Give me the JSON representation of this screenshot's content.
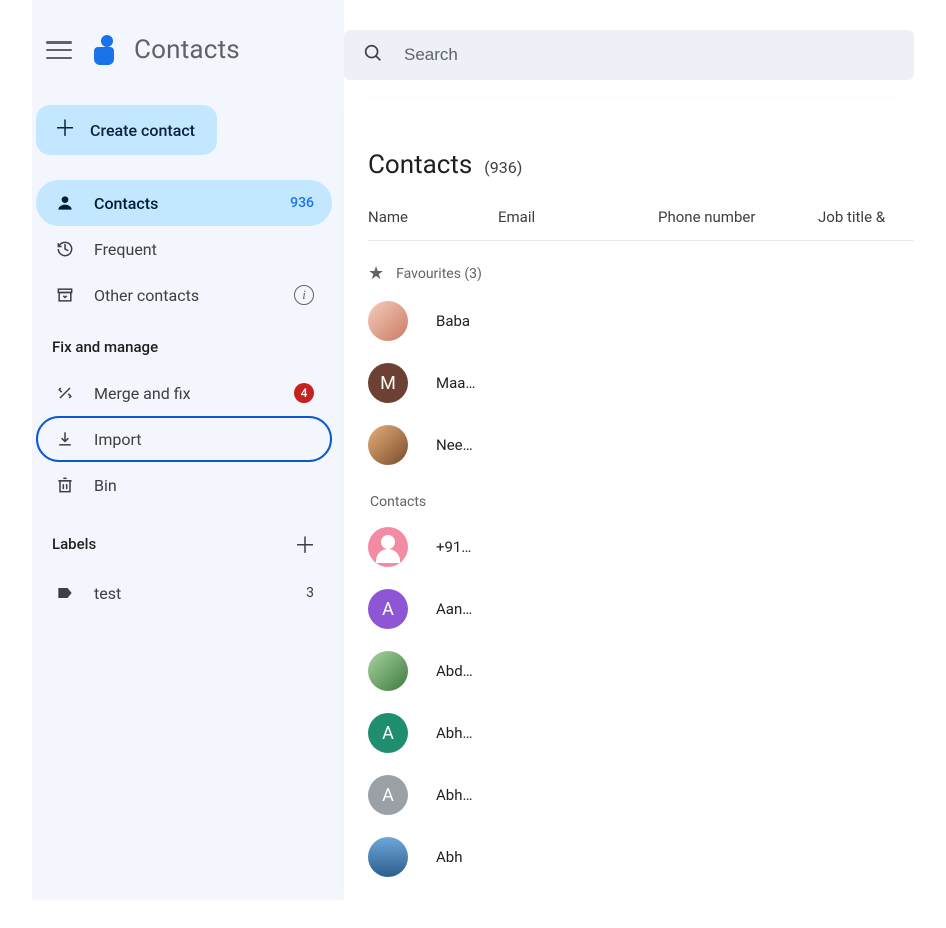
{
  "app": {
    "title": "Contacts"
  },
  "search": {
    "placeholder": "Search"
  },
  "sidebar": {
    "create_label": "Create contact",
    "nav": {
      "contacts": {
        "label": "Contacts",
        "count": "936"
      },
      "frequent": {
        "label": "Frequent"
      },
      "other": {
        "label": "Other contacts"
      }
    },
    "section_fix": "Fix and manage",
    "fix": {
      "merge": {
        "label": "Merge and fix",
        "badge": "4"
      },
      "import": {
        "label": "Import"
      },
      "bin": {
        "label": "Bin"
      }
    },
    "labels_heading": "Labels",
    "labels": [
      {
        "label": "test",
        "count": "3"
      }
    ]
  },
  "main": {
    "heading": "Contacts",
    "count_paren": "(936)",
    "columns": [
      "Name",
      "Email",
      "Phone number",
      "Job title &"
    ],
    "fav_heading": "Favourites (3)",
    "favourites": [
      {
        "name": "Baba",
        "avatar_type": "photo1",
        "initial": ""
      },
      {
        "name": "Maa…",
        "avatar_type": "solid",
        "initial": "M",
        "color": "#6d4034"
      },
      {
        "name": "Nee…",
        "avatar_type": "photo3",
        "initial": ""
      }
    ],
    "contacts_heading": "Contacts",
    "contacts": [
      {
        "name": "+91…",
        "avatar_type": "default",
        "initial": "",
        "color": ""
      },
      {
        "name": "Aan…",
        "avatar_type": "solid",
        "initial": "A",
        "color": "#8e55d4"
      },
      {
        "name": "Abd…",
        "avatar_type": "photo2",
        "initial": "",
        "color": ""
      },
      {
        "name": "Abh…",
        "avatar_type": "solid",
        "initial": "A",
        "color": "#1e8e6e"
      },
      {
        "name": "Abh…",
        "avatar_type": "solid",
        "initial": "A",
        "color": "#9aa0a6"
      },
      {
        "name": "Abh",
        "avatar_type": "gradblue",
        "initial": "",
        "color": ""
      }
    ]
  }
}
